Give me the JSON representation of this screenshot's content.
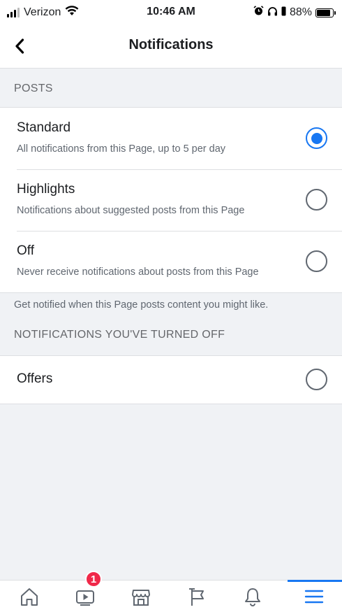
{
  "status_bar": {
    "carrier": "Verizon",
    "time": "10:46 AM",
    "battery": "88%",
    "battery_level": 0.88
  },
  "nav": {
    "title": "Notifications",
    "back_icon": "chevron-left-icon"
  },
  "posts_section": {
    "header": "POSTS",
    "options": [
      {
        "title": "Standard",
        "description": "All notifications from this Page, up to 5 per day",
        "selected": true
      },
      {
        "title": "Highlights",
        "description": "Notifications about suggested posts from this Page",
        "selected": false
      },
      {
        "title": "Off",
        "description": "Never receive notifications about posts from this Page",
        "selected": false
      }
    ],
    "footer": "Get notified when this Page posts content you might like."
  },
  "turned_off_section": {
    "header": "NOTIFICATIONS YOU'VE TURNED OFF",
    "options": [
      {
        "title": "Offers",
        "selected": false
      }
    ]
  },
  "tab_bar": {
    "tabs": [
      {
        "icon": "home-icon",
        "active": false
      },
      {
        "icon": "video-icon",
        "active": false,
        "badge": "1"
      },
      {
        "icon": "marketplace-icon",
        "active": false
      },
      {
        "icon": "pages-flag-icon",
        "active": false
      },
      {
        "icon": "bell-icon",
        "active": false
      },
      {
        "icon": "menu-icon",
        "active": true
      }
    ]
  },
  "colors": {
    "accent": "#1877f2",
    "badge": "#f02849",
    "background": "#f0f2f5"
  }
}
